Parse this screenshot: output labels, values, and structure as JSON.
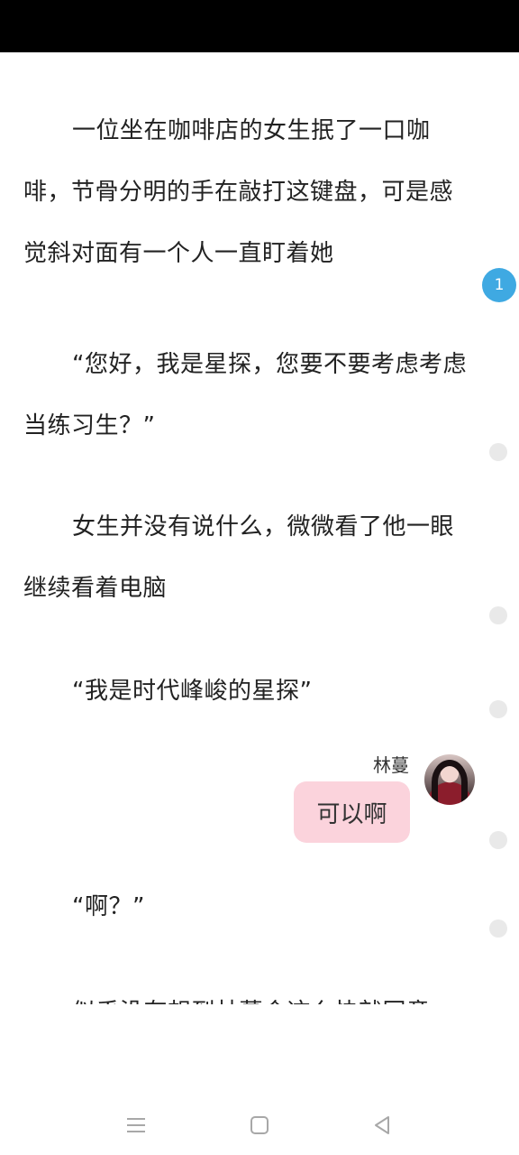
{
  "paragraphs": [
    "一位坐在咖啡店的女生抿了一口咖啡，节骨分明的手在敲打这键盘，可是感觉斜对面有一个人一直盯着她",
    "“您好，我是星探，您要不要考虑考虑当练习生？”",
    "女生并没有说什么，微微看了他一眼继续看着电脑",
    "“我是时代峰峻的星探”",
    "“啊？”",
    "似乎没有想到林蔓会这么快就同意"
  ],
  "chat": {
    "name": "林蔓",
    "message": "可以啊"
  },
  "comment_badge": "1",
  "nav": {
    "menu_icon": "menu-icon",
    "home_icon": "home-square-icon",
    "back_icon": "back-triangle-icon"
  },
  "colors": {
    "bubble": "#fbd3dc",
    "badge": "#3fa9e2",
    "status_bar": "#000000"
  }
}
